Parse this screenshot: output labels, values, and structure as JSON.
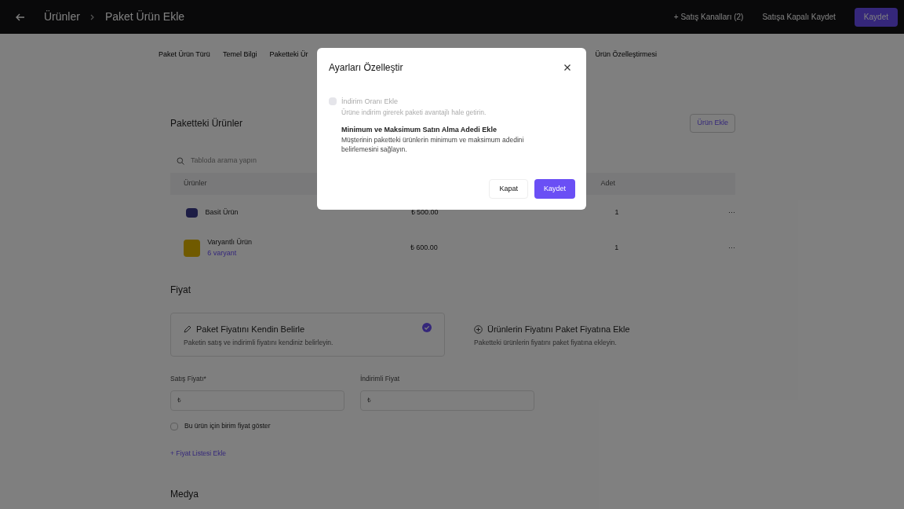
{
  "header": {
    "breadcrumb": [
      "Ürünler",
      "Paket Ürün Ekle"
    ],
    "channels_link": "+ Satış Kanalları (2)",
    "save_closed_button": "Satışa Kapalı Kaydet",
    "save_button": "Kaydet"
  },
  "tabs": [
    {
      "label": "Paket Ürün Türü",
      "selected": false
    },
    {
      "label": "Temel Bilgi",
      "selected": false
    },
    {
      "label": "Paketteki Ür",
      "selected": false
    },
    {
      "label": "Ürün Özelleştirmesi",
      "selected": false
    }
  ],
  "products_section": {
    "title": "Paketteki Ürünler",
    "add_button": "Ürün Ekle",
    "search_placeholder": "Tabloda arama yapın",
    "columns": [
      "Ürünler",
      "Adet"
    ],
    "rows": [
      {
        "name": "Basit Ürün",
        "variants": null,
        "price": "₺ 500.00",
        "quantity": "1",
        "menu": "···"
      },
      {
        "name": "Varyantlı Ürün",
        "variants": "6 varyant",
        "price": "₺ 600.00",
        "quantity": "1",
        "menu": "···"
      }
    ]
  },
  "price_section": {
    "title": "Fiyat",
    "options": [
      {
        "kind": "pencil",
        "title": "Paket Fiyatını Kendin Belirle",
        "description": "Paketin satış ve indirimli fiyatını kendiniz belirleyin.",
        "selected": true
      },
      {
        "kind": "plus",
        "title": "Ürünlerin Fiyatını Paket Fiyatına Ekle",
        "description": "Paketteki ürünlerin fiyatını paket fiyatına ekleyin.",
        "selected": false
      }
    ],
    "fields": [
      {
        "label": "Satış Fiyatı*",
        "prefix": "₺"
      },
      {
        "label": "İndirimli Fiyat",
        "prefix": "₺"
      }
    ],
    "unit_price": {
      "label": "Bu ürün için birim fiyat göster",
      "checked": false
    },
    "price_list_link": "+ Fiyat Listesi Ekle"
  },
  "media_section": {
    "title": "Medya"
  },
  "modal": {
    "title": "Ayarları Özelleştir",
    "options": [
      {
        "kind": "checkbox",
        "title": "İndirim Oranı Ekle",
        "description": "Ürüne indirim girerek paketi avantajlı hale getirin.",
        "checked": false,
        "disabled": true
      },
      {
        "kind": "text",
        "title": "Minimum ve Maksimum Satın Alma Adedi Ekle",
        "description": "Müşterinin paketteki ürünlerin minimum ve maksimum adedini belirlemesini sağlayın.",
        "disabled": false
      }
    ],
    "close_button": "Kapat",
    "save_button": "Kaydet"
  }
}
